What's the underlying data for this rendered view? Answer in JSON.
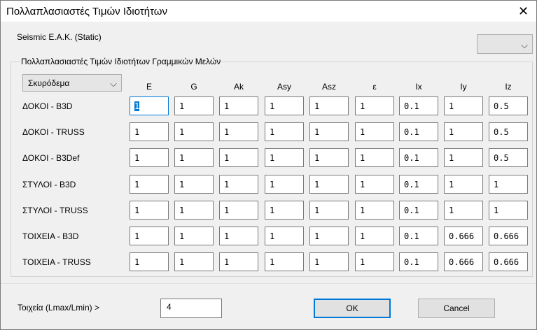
{
  "window": {
    "title": "Πολλαπλασιαστές Τιμών Ιδιοτήτων",
    "close_symbol": "✕"
  },
  "analysis_label": "Seismic Ε.Α.Κ. (Static)",
  "analysis_combo": {
    "value": ""
  },
  "group": {
    "legend": "Πολλαπλασιαστές Τιμών Ιδιοτήτων Γραμμικών Μελών",
    "material": "Σκυρόδεμα",
    "columns": [
      "E",
      "G",
      "Ak",
      "Asy",
      "Asz",
      "ε",
      "Ix",
      "Iy",
      "Iz"
    ],
    "rows": [
      {
        "label": "ΔΟΚΟΙ - B3D",
        "values": [
          "1",
          "1",
          "1",
          "1",
          "1",
          "1",
          "0.1",
          "1",
          "0.5"
        ]
      },
      {
        "label": "ΔΟΚΟΙ - TRUSS",
        "values": [
          "1",
          "1",
          "1",
          "1",
          "1",
          "1",
          "0.1",
          "1",
          "0.5"
        ]
      },
      {
        "label": "ΔΟΚΟΙ - B3Def",
        "values": [
          "1",
          "1",
          "1",
          "1",
          "1",
          "1",
          "0.1",
          "1",
          "0.5"
        ]
      },
      {
        "label": "ΣΤΥΛΟΙ - B3D",
        "values": [
          "1",
          "1",
          "1",
          "1",
          "1",
          "1",
          "0.1",
          "1",
          "1"
        ]
      },
      {
        "label": "ΣΤΥΛΟΙ - TRUSS",
        "values": [
          "1",
          "1",
          "1",
          "1",
          "1",
          "1",
          "0.1",
          "1",
          "1"
        ]
      },
      {
        "label": "ΤΟΙΧΕΙΑ - B3D",
        "values": [
          "1",
          "1",
          "1",
          "1",
          "1",
          "1",
          "0.1",
          "0.666",
          "0.666"
        ]
      },
      {
        "label": "ΤΟΙΧΕΙΑ - TRUSS",
        "values": [
          "1",
          "1",
          "1",
          "1",
          "1",
          "1",
          "0.1",
          "0.666",
          "0.666"
        ]
      }
    ]
  },
  "ratio": {
    "label": "Τοιχεία (Lmax/Lmin) >",
    "value": "4"
  },
  "buttons": {
    "ok": "OK",
    "cancel": "Cancel"
  },
  "icons": {
    "chevron": "chevron-down-icon",
    "close": "close-icon"
  },
  "colors": {
    "focus_accent": "#0078d7"
  }
}
